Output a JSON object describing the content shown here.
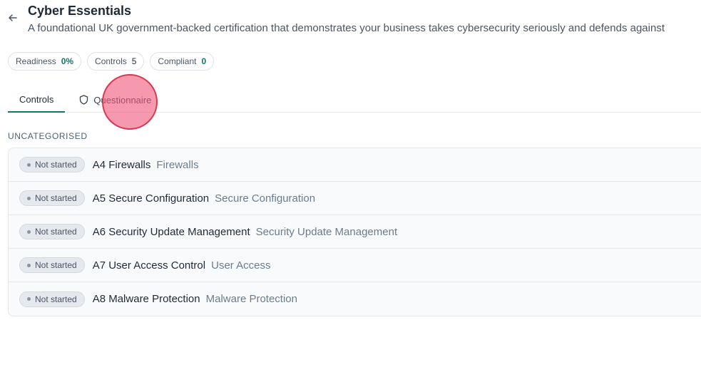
{
  "header": {
    "title": "Cyber Essentials",
    "subtitle": "A foundational UK government-backed certification that demonstrates your business takes cybersecurity seriously and defends against"
  },
  "stats": [
    {
      "label": "Readiness",
      "value": "0%"
    },
    {
      "label": "Controls",
      "value": "5"
    },
    {
      "label": "Compliant",
      "value": "0"
    }
  ],
  "tabs": [
    {
      "label": "Controls"
    },
    {
      "label": "Questionnaire"
    }
  ],
  "section": {
    "label": "UNCATEGORISED"
  },
  "controls": [
    {
      "status": "Not started",
      "code": "A4 Firewalls",
      "category": "Firewalls"
    },
    {
      "status": "Not started",
      "code": "A5 Secure Configuration",
      "category": "Secure Configuration"
    },
    {
      "status": "Not started",
      "code": "A6 Security Update Management",
      "category": "Security Update Management"
    },
    {
      "status": "Not started",
      "code": "A7 User Access Control",
      "category": "User Access"
    },
    {
      "status": "Not started",
      "code": "A8 Malware Protection",
      "category": "Malware Protection"
    }
  ],
  "colors": {
    "accent": "#0f766e",
    "cursor_marker": "#f05578"
  },
  "icons": {
    "back": "arrow-left-icon",
    "questionnaire": "shield-icon"
  }
}
